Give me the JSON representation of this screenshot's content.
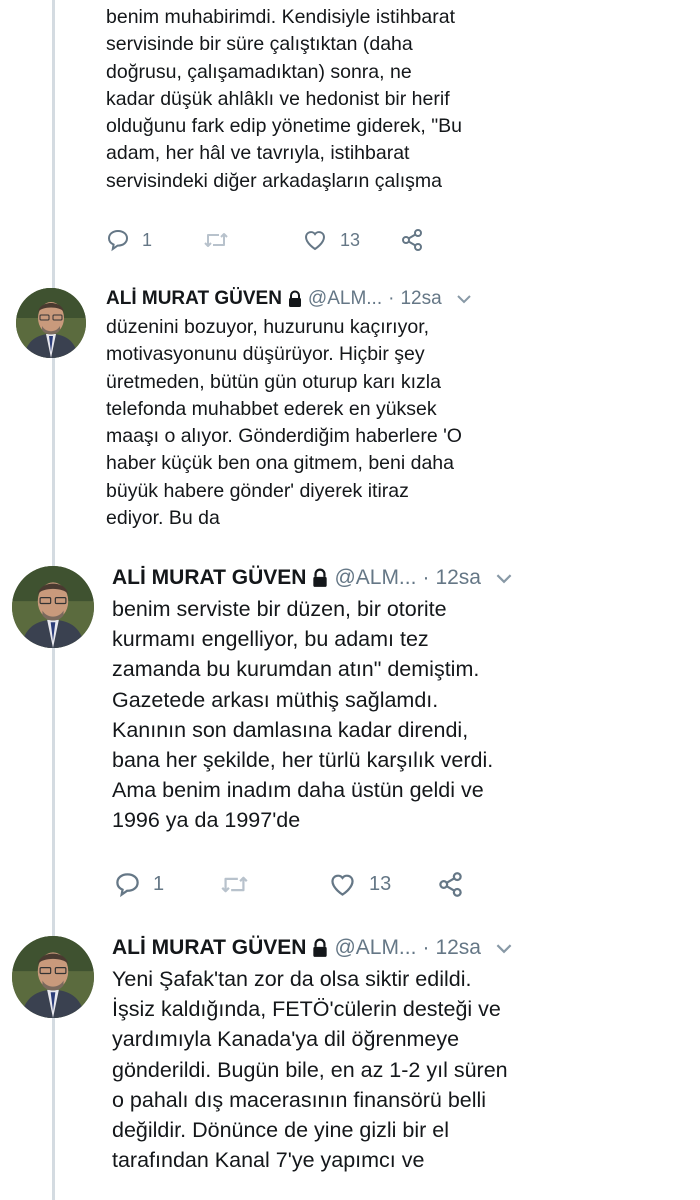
{
  "tweets": [
    {
      "text": "benim muhabirimdi. Kendisiyle istihbarat\nservisinde bir süre çalıştıktan (daha\ndoğrusu, çalışamadıktan) sonra, ne\nkadar düşük ahlâklı ve hedonist bir herif\nolduğunu fark edip yönetime giderek, \"Bu\nadam, her hâl ve tavrıyla, istihbarat\nservisindeki diğer arkadaşların çalışma",
      "reply_count": "1",
      "like_count": "13"
    },
    {
      "author": "ALİ MURAT GÜVEN",
      "handle": "@ALM...",
      "separator": "·",
      "time": "12sa",
      "text": "düzenini bozuyor, huzurunu kaçırıyor,\nmotivasyonunu düşürüyor. Hiçbir şey\nüretmeden, bütün gün oturup karı kızla\ntelefonda muhabbet ederek en yüksek\nmaaşı o alıyor. Gönderdiğim haberlere 'O\nhaber küçük ben ona gitmem, beni daha\nbüyük habere gönder' diyerek itiraz\nediyor. Bu da"
    },
    {
      "author": "ALİ MURAT GÜVEN",
      "handle": "@ALM...",
      "separator": "·",
      "time": "12sa",
      "text": "benim serviste bir düzen, bir otorite\nkurmamı engelliyor, bu adamı tez\nzamanda bu kurumdan atın\" demiştim.\nGazetede arkası müthiş sağlamdı.\nKanının son damlasına kadar direndi,\nbana her şekilde, her türlü karşılık verdi.\nAma benim inadım daha üstün geldi ve\n1996 ya da 1997'de",
      "reply_count": "1",
      "like_count": "13"
    },
    {
      "author": "ALİ MURAT GÜVEN",
      "handle": "@ALM...",
      "separator": "·",
      "time": "12sa",
      "text": "Yeni Şafak'tan zor da olsa siktir edildi.\nİşsiz kaldığında, FETÖ'cülerin desteği ve\nyardımıyla Kanada'ya dil öğrenmeye\ngönderildi. Bugün bile, en az 1-2 yıl süren\no pahalı dış macerasının finansörü belli\ndeğildir. Dönünce de yine gizli bir el\ntarafından Kanal 7'ye yapımcı ve"
    }
  ],
  "icons": {
    "reply": "reply-icon",
    "retweet": "retweet-icon",
    "like": "like-icon",
    "share": "share-icon",
    "lock": "lock-icon",
    "menu": "chevron-down-icon"
  },
  "colors": {
    "text": "#14171a",
    "muted": "#657786",
    "thread_line": "#d4dbe1"
  }
}
